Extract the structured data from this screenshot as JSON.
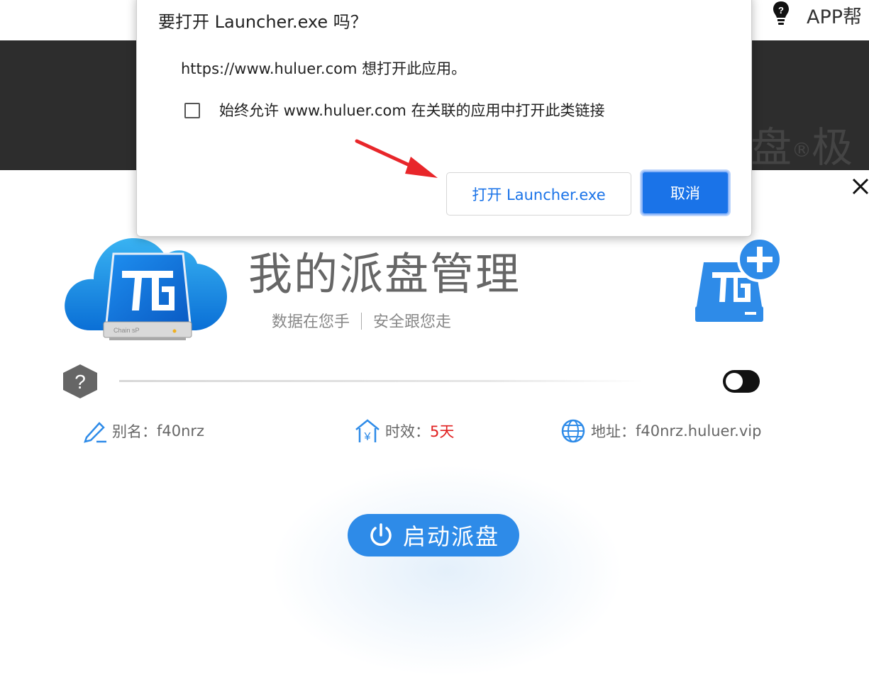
{
  "header": {
    "help_label": "APP帮",
    "help_icon": "lightbulb-icon"
  },
  "hero": {
    "text": "盘",
    "reg": "®",
    "text2": "极"
  },
  "panel": {
    "title": "我的派盘管理",
    "subtitle_left": "数据在您手",
    "subtitle_right": "安全跟您走",
    "logo_caption": "Chain sP",
    "info": {
      "alias_label": "别名：",
      "alias_value": "f40nrz",
      "validity_label": "时效：",
      "validity_value": "5天",
      "address_label": "地址：",
      "address_value": "f40nrz.huluer.vip"
    },
    "toggle_on": true,
    "start_label": "启动派盘"
  },
  "dialog": {
    "title": "要打开 Launcher.exe 吗？",
    "message": "https://www.huluer.com 想打开此应用。",
    "checkbox_label": "始终允许 www.huluer.com 在关联的应用中打开此类链接",
    "checkbox_checked": false,
    "open_button": "打开 Launcher.exe",
    "cancel_button": "取消"
  },
  "colors": {
    "accent": "#1a73e8",
    "start_button": "#2e8be8",
    "validity_red": "#e02020",
    "dark_band": "#2d2d2d"
  }
}
